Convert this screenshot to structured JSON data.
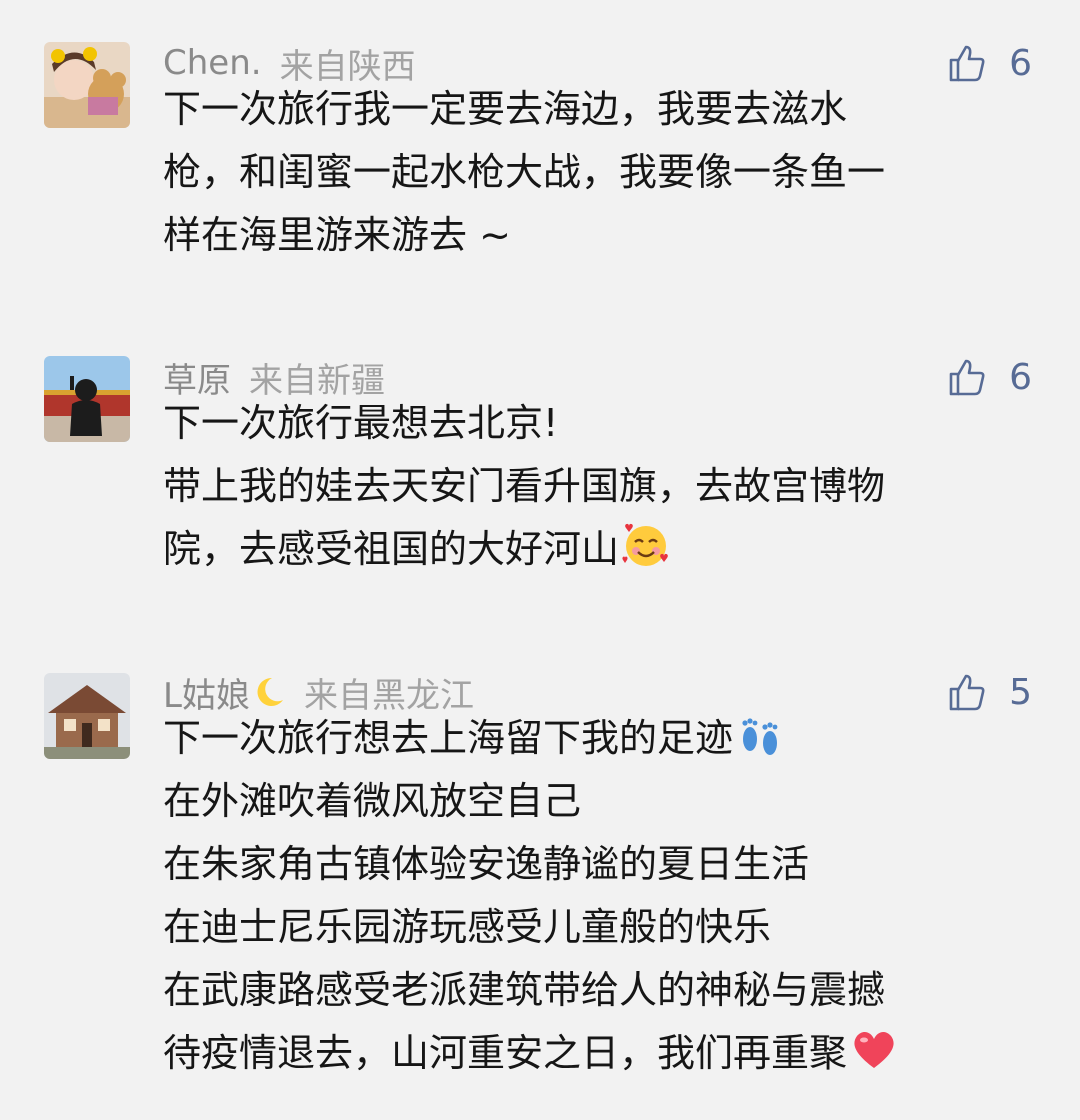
{
  "comments": [
    {
      "nickname": "Chen.",
      "location": "来自陕西",
      "likes": "6",
      "lines": [
        "下一次旅行我一定要去海边，我要去滋水",
        "枪，和闺蜜一起水枪大战，我要像一条鱼一",
        "样在海里游来游去 ~"
      ]
    },
    {
      "nickname": "草原",
      "location": "来自新疆",
      "likes": "6",
      "lines": [
        "下一次旅行最想去北京!",
        "带上我的娃去天安门看升国旗，去故宫博物",
        "院，去感受祖国的大好河山"
      ],
      "emoji": "smiling-face-with-hearts-emoji"
    },
    {
      "nickname": "L姑娘",
      "nickname_icon": "crescent-moon-icon",
      "location": "来自黑龙江",
      "likes": "5",
      "lines": [
        "下一次旅行想去上海留下我的足迹",
        "在外滩吹着微风放空自己",
        "在朱家角古镇体验安逸静谧的夏日生活",
        "在迪士尼乐园游玩感受儿童般的快乐",
        "在武康路感受老派建筑带给人的神秘与震撼",
        "待疫情退去，山河重安之日，我们再重聚"
      ],
      "emojis": [
        "footprints-emoji",
        "red-heart-emoji"
      ]
    }
  ],
  "colors": {
    "background": "#f2f2f2",
    "text": "#161616",
    "meta": "#8a8a8a",
    "like_accent": "#576b95"
  }
}
